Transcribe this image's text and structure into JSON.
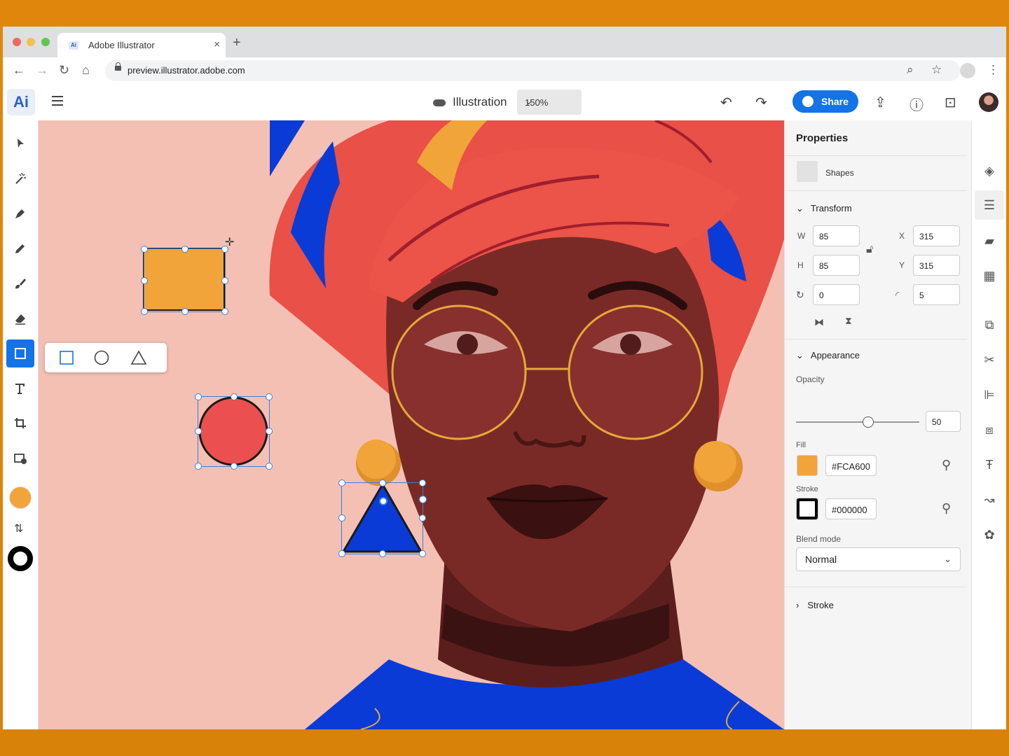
{
  "browser": {
    "tab_title": "Adobe Illustrator",
    "tab_favicon": "Ai",
    "new_tab": "+",
    "close_tab": "×",
    "url": "preview.illustrator.adobe.com"
  },
  "app": {
    "logo": "Ai",
    "document_name": "Illustration",
    "zoom": "150%",
    "share_label": "Share"
  },
  "toolbar": {
    "tools": [
      "selection-tool",
      "magic-wand-tool",
      "pen-tool",
      "pencil-tool",
      "paintbrush-tool",
      "eraser-tool",
      "shape-tool",
      "type-tool",
      "crop-tool",
      "place-image-tool"
    ],
    "active_tool": "shape-tool",
    "fill_color": "#f0a43a",
    "stroke_color": "#000000"
  },
  "shape_flyout": [
    "rectangle",
    "ellipse",
    "triangle"
  ],
  "canvas": {
    "background": "#f4c0b4",
    "shapes": [
      {
        "type": "rectangle",
        "fill": "#f0a43a",
        "stroke": "#1a1a1a"
      },
      {
        "type": "ellipse",
        "fill": "#ec4f4f",
        "stroke": "#1a1a1a"
      },
      {
        "type": "triangle",
        "fill": "#0a3bd6",
        "stroke": "#1a1a1a"
      }
    ]
  },
  "properties": {
    "title": "Properties",
    "selection_label": "Shapes",
    "transform": {
      "label": "Transform",
      "w_label": "W",
      "w": "85",
      "h_label": "H",
      "h": "85",
      "x_label": "X",
      "x": "315",
      "y_label": "Y",
      "y": "315",
      "rotation": "0",
      "corner_radius": "5"
    },
    "appearance": {
      "label": "Appearance",
      "opacity_label": "Opacity",
      "opacity": "50",
      "fill_label": "Fill",
      "fill_hex": "#FCA600",
      "fill_color": "#f0a43a",
      "stroke_label": "Stroke",
      "stroke_hex": "#000000",
      "blend_label": "Blend mode",
      "blend_mode": "Normal"
    },
    "stroke_section": "Stroke"
  },
  "colors": {
    "accent": "#1473e6",
    "panel_bg": "#f5f5f5"
  }
}
